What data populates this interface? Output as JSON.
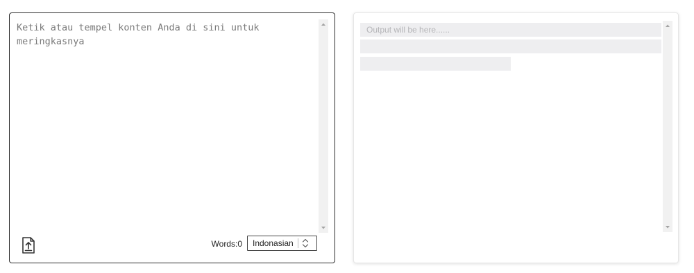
{
  "input_panel": {
    "placeholder": "Ketik atau tempel konten Anda di sini untuk meringkasnya",
    "upload_icon": "upload-icon",
    "word_count_label": "Words:0",
    "language": {
      "selected": "Indonasian",
      "icon": "up-down-chevron-icon"
    }
  },
  "output_panel": {
    "placeholder": "Output will be here......"
  },
  "colors": {
    "input_border": "#2b2b2b",
    "placeholder_text": "#7a7a7a",
    "skeleton_bar": "#eeeef0",
    "scrollbar_track": "#f1f1f1"
  }
}
